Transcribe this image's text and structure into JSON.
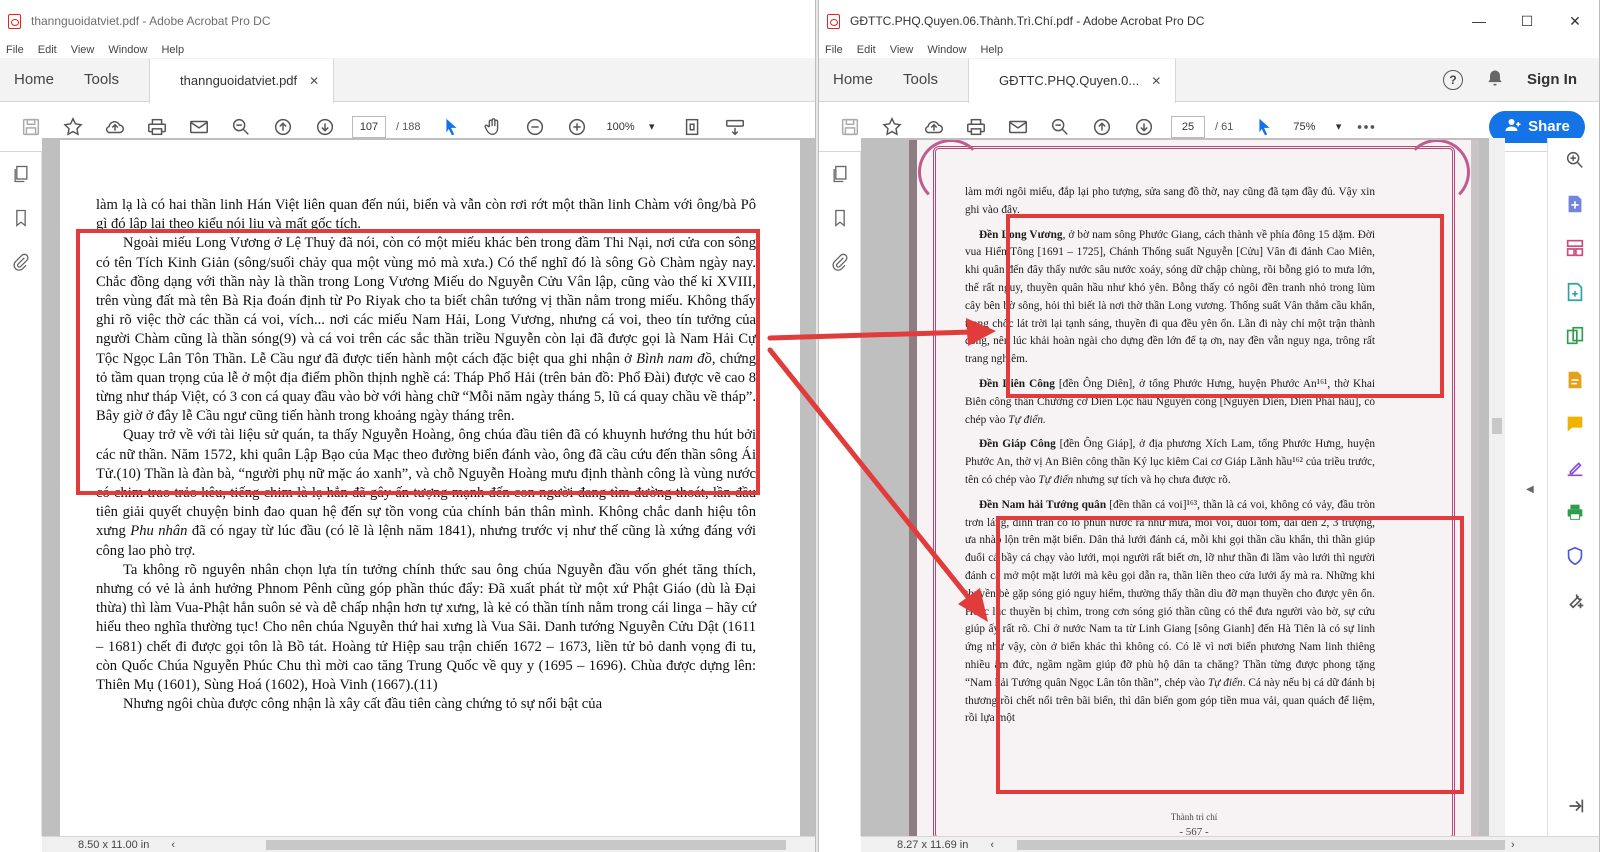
{
  "left_window": {
    "title": "thannguoidatviet.pdf - Adobe Acrobat Pro DC",
    "menu": [
      "File",
      "Edit",
      "View",
      "Window",
      "Help"
    ],
    "tabs": {
      "home": "Home",
      "tools": "Tools",
      "document": "thannguoidatviet.pdf",
      "close": "✕"
    },
    "toolbar": {
      "page_current": "107",
      "page_total": "/ 188",
      "zoom": "100%"
    },
    "page_size": "8.50 x 11.00 in",
    "document_text": {
      "p0": "làm lạ là có hai thần linh Hán Việt liên quan đến núi, biển và vẫn còn rơi rớt một thần linh Chàm với ông/bà Pô gì đó lập lại theo kiểu nói lịu và mất gốc tích.",
      "p1": "Ngoài miếu Long Vương ở Lệ Thuỷ đã nói, còn có một miếu khác bên trong đầm Thi Nại, nơi cửa con sông có tên Tích Kinh Giản (sông/suối chảy qua một vùng mỏ mà xưa.) Có thể nghĩ đó là sông Gò Chàm ngày nay. Chắc đồng dạng với thần này là thần trong Long Vương Miếu do Nguyễn Cửu Vân lập, cũng vào thế kỉ XVIII, trên vùng đất mà tên Bà Rịa đoán định từ Po Riyak cho ta biết chân tướng vị thần nằm trong miếu. Không thấy ghi rõ việc thờ các thần cá voi, vích... nơi các miếu Nam Hải, Long Vương, nhưng cá voi, theo tín tưởng của người Chàm cũng là thần sóng(9) và cá voi trên các sắc thần triều Nguyễn còn lại đã được gọi là Nam Hải Cự Tộc Ngọc Lân Tôn Thần. Lễ Cầu ngư đã được tiến hành một cách đặc biệt qua ghi nhận ở",
      "p1_italic": "Bình nam đồ",
      "p1_tail": ", chứng tỏ tầm quan trọng của lễ ở một địa điểm phồn thịnh nghề cá: Tháp Phổ Hải (trên bản đồ: Phổ Đài) được vẽ cao 8 từng như tháp Việt, có 3 con cá quay đầu vào bờ với hàng chữ “Mỗi năm ngày tháng 5, lũ cá quay chầu về tháp”. Bây giờ ở đây lễ Cầu ngư cũng tiến hành trong khoảng ngày tháng trên.",
      "p2": "Quay trở về với tài liệu sử quán, ta thấy Nguyễn Hoàng, ông chúa đầu tiên đã có khuynh hướng thu hút bởi các nữ thần. Năm 1572, khi quân Lập Bạo của Mạc theo đường biển đánh vào, ông đã cầu cứu đến thần sông Ái Tử.(10) Thần là đàn bà, “người phụ nữ mặc áo xanh”, và chỗ Nguyễn Hoàng mưu định thành công là vùng nước có chim trao trảo kêu, tiếng chim là lạ hẳn đã gây ấn tượng mạnh đến con người đang tìm đường thoát, lần đầu tiên giải quyết chuyện binh đao quan hệ đến sự tồn vong của chính bản thân mình. Không chắc danh hiệu tôn xưng",
      "p2_italic": "Phu nhân",
      "p2_tail": "đã có ngay từ lúc đầu (có lẽ là lệnh năm 1841), nhưng trước vị như thế cũng là xứng đáng với công lao phò trợ.",
      "p3": "Ta không rõ nguyên nhân chọn lựa tín tưởng chính thức sau ông chúa Nguyễn đầu vốn ghét tăng thích, nhưng có vẻ là ảnh hưởng Phnom Pênh cũng góp phần thúc đẩy: Đã xuất phát từ một xứ Phật Giáo (dù là Đại thừa) thì làm Vua-Phật hẳn suôn sẻ và dễ chấp nhận hơn tự xưng, là kẻ có thần tính nằm trong cái linga – hãy cứ hiểu theo nghĩa thường tục! Cho nên chúa Nguyễn thứ hai xưng là Vua Sãi. Danh tướng Nguyễn Cửu Dật (1611 – 1681) chết đi được gọi tôn là Bồ tát. Hoàng tử Hiệp sau trận chiến 1672 – 1673, liền tử bỏ danh vọng đi tu, còn Quốc Chúa Nguyễn Phúc Chu thì mời cao tăng Trung Quốc về quy y (1695 – 1696). Chùa được dựng lên: Thiên Mụ (1601), Sùng Hoá (1602), Hoà Vinh (1667).(11)",
      "p4": "Nhưng ngôi chùa được công nhận là xây cất đầu tiên càng chứng tỏ sự nổi bật của"
    }
  },
  "right_window": {
    "title": "GĐTTC.PHQ.Quyen.06.Thành.Trì.Chí.pdf - Adobe Acrobat Pro DC",
    "menu": [
      "File",
      "Edit",
      "View",
      "Window",
      "Help"
    ],
    "tabs": {
      "home": "Home",
      "tools": "Tools",
      "document": "GĐTTC.PHQ.Quyen.0...",
      "close": "✕"
    },
    "sign_in": "Sign In",
    "help_glyph": "?",
    "share_label": "Share",
    "toolbar": {
      "page_current": "25",
      "page_total": "/ 61",
      "zoom": "75%"
    },
    "page_size": "8.27 x 11.69 in",
    "document_text": {
      "p0": "làm mới ngôi miếu, đắp lại pho tượng, sửa sang đồ thờ, nay cũng đã tạm đầy đủ. Vậy xin ghi vào đây.",
      "p1_bold": "Đền Long Vương",
      "p1": ", ở bờ nam sông Phước Giang, cách thành về phía đông 15 dặm. Đời vua Hiển Tông [1691 – 1725], Chánh Thống suất Nguyễn [Cửu] Vân đi đánh Cao Miên, khi quân đến đây thấy nước sâu nước xoáy, sóng dữ chập chùng, rồi bỗng gió to mưa lớn, thế rất nguy, thuyền quân hầu như khó yên. Bỗng thấy có ngôi đền tranh nhỏ trong lùm cây bên bờ sông, hỏi thì biết là nơi thờ thần Long vương. Thống suất Vân thắm cầu khẩn, trong chốc lát trời lại tạnh sáng, thuyền đi qua đều yên ổn. Lần đi này chỉ một trận thành công, nên lúc khải hoàn ngài cho dựng đền lớn để tạ ơn, nay đền vẫn nguy nga, trông rất trang nghiêm.",
      "p2_bold": "Đền Diên Công",
      "p2": "[đền Ông Diên], ở tổng Phước Hưng, huyện Phước An¹⁶¹, thờ Khai Biên công thần Chưởng cơ Diên Lộc hầu Nguyễn công [Nguyễn Diên, Diên Phái hầu], có chép vào",
      "p2_italic": "Tự điển.",
      "p3_bold": "Đền Giáp Công",
      "p3": "[đền Ông Giáp], ở địa phương Xích Lam, tổng Phước Hưng, huyện Phước An, thờ vị An Biên công thần Ký lục kiêm Cai cơ Giáp Lãnh hầu¹⁶² của triều trước, tên có chép vào",
      "p3_italic": "Tự điển",
      "p3_tail": "nhưng sự tích và họ chưa được rõ.",
      "p4_bold": "Đền Nam hải Tướng quân",
      "p4": "[đền thần cá voi]¹⁶³, thần là cá voi, không có vảy, đầu tròn trơn láng, đỉnh trán có lỗ phun nước ra như mưa, mỗi voi, đuôi tôm, dài đến 2, 3 trượng, ưa nhào lộn trên mặt biển. Dân thả lưới đánh cá, mỗi khi gọi thần cầu khẩn, thì thần giúp đuổi cả bầy cá chạy vào lưới, mọi người rất biết ơn, lỡ như thần đi lầm vào lưới thì người đánh cá mở một mặt lưới mà kêu gọi dẫn ra, thần liền theo cửa lưới ấy mà ra. Những khi thuyền bè gặp sóng gió nguy hiểm, thường thấy thần dìu đỡ mạn thuyền cho được yên ổn. Hoặc lúc thuyền bị chìm, trong cơn sóng gió thần cũng có thể đưa người vào bờ, sự cứu giúp ấy rất rõ. Chỉ ở nước Nam ta từ Linh Giang [sông Gianh] đến Hà Tiên là có sự linh ứng như vậy, còn ở biển khác thì không có. Có lẽ vì nơi biển phương Nam linh thiêng nhiều âm đức, ngầm ngầm giúp đỡ phù hộ dân ta chăng? Thần từng được phong tặng “Nam hải Tướng quân Ngọc Lân tôn thần”, chép vào",
      "p4_italic": "Tự điển",
      "p4_tail": ". Cá này nếu bị cá dữ đánh bị thương rồi chết nổi trên bãi biển, thì dân biển gom góp tiền mua vải, quan quách để liệm, rồi lựa một",
      "book_footer": "Thành trì chí",
      "page_number": "- 567 -"
    }
  },
  "colors": {
    "highlight": "#e23b3b",
    "accent": "#1473e6",
    "acrobat_red": "#e0261b"
  }
}
